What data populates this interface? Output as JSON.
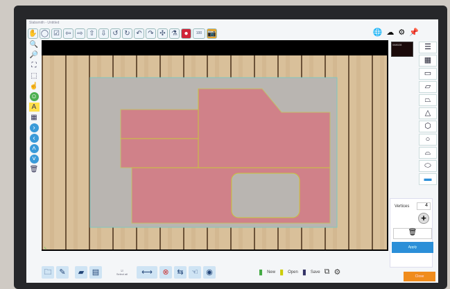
{
  "window": {
    "title": "Slabsmith - Untitled"
  },
  "top_toolbar": {
    "zoom_value": "100"
  },
  "minimap": {
    "label": "088028"
  },
  "vertices": {
    "label": "Vertices",
    "value": "4"
  },
  "buttons": {
    "apply": "Apply",
    "close": "Close",
    "new": "New",
    "open": "Open",
    "save": "Save",
    "select_all": "Select all"
  },
  "colors": {
    "shape_fill": "#e06070",
    "slab": "#b8b4b0",
    "accent": "#2b8fd8"
  }
}
